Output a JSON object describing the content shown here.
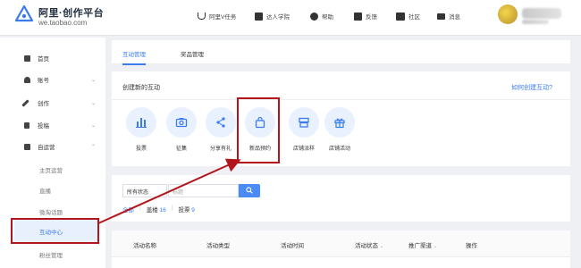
{
  "header": {
    "logo_title": "阿里·创作平台",
    "logo_url": "we.taobao.com",
    "nav": [
      "阿里V任务",
      "达人学院",
      "帮助",
      "反馈",
      "社区",
      "消息"
    ]
  },
  "sidebar": {
    "items": [
      {
        "label": "首页"
      },
      {
        "label": "账号"
      },
      {
        "label": "创作"
      },
      {
        "label": "投稿"
      },
      {
        "label": "自运营"
      }
    ],
    "sub_items": [
      "主页运营",
      "直播",
      "微淘话题",
      "互动中心",
      "粉丝管理"
    ]
  },
  "tabs": [
    "互动管理",
    "奖品管理"
  ],
  "create_card": {
    "title": "创建新的互动",
    "help_link": "如何创建互动?",
    "activities": [
      {
        "label": "投票",
        "icon": "bar-chart-icon"
      },
      {
        "label": "征集",
        "icon": "camera-icon"
      },
      {
        "label": "分享有礼",
        "icon": "share-icon"
      },
      {
        "label": "新品预约",
        "icon": "shopping-bag-icon"
      },
      {
        "label": "店铺派样",
        "icon": "store-icon"
      },
      {
        "label": "店铺活动",
        "icon": "gift-icon"
      }
    ]
  },
  "filter": {
    "status_select": "所有状态",
    "search_placeholder": "标题",
    "type_tabs": [
      {
        "label": "全部",
        "count": ""
      },
      {
        "label": "盖楼",
        "count": "16"
      },
      {
        "label": "投票",
        "count": "9"
      }
    ]
  },
  "table": {
    "columns": [
      "活动名称",
      "活动类型",
      "活动时间",
      "活动状态",
      "推广渠道",
      "操作"
    ]
  },
  "colors": {
    "accent": "#3a7cf0",
    "annotation": "#b2161c"
  }
}
